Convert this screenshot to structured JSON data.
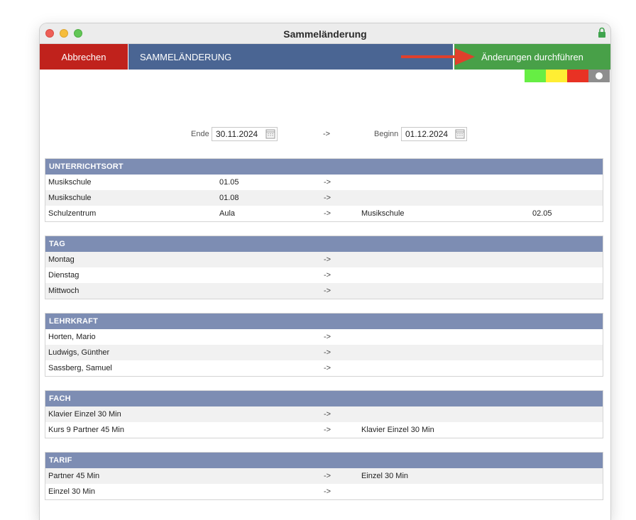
{
  "window": {
    "title": "Sammeländerung"
  },
  "toolbar": {
    "cancel_label": "Abbrechen",
    "title": "SAMMELÄNDERUNG",
    "execute_label": "Änderungen durchführen"
  },
  "colors": {
    "cancel": "#c0221c",
    "header": "#4a6593",
    "execute": "#48a048",
    "section": "#7d8db3",
    "swatches": [
      "#66ee44",
      "#ffee33",
      "#e83224",
      "#8e8e8e"
    ]
  },
  "dates": {
    "end_label": "Ende",
    "end_value": "30.11.2024",
    "arrow": "->",
    "begin_label": "Beginn",
    "begin_value": "01.12.2024"
  },
  "sections": [
    {
      "title": "UNTERRICHTSORT",
      "rows": [
        {
          "c1": "Musikschule",
          "c2": "01.05",
          "arrow": "->",
          "c4": "",
          "c5": ""
        },
        {
          "c1": "Musikschule",
          "c2": "01.08",
          "arrow": "->",
          "c4": "",
          "c5": ""
        },
        {
          "c1": "Schulzentrum",
          "c2": "Aula",
          "arrow": "->",
          "c4": "Musikschule",
          "c5": "02.05"
        }
      ]
    },
    {
      "title": "TAG",
      "rows": [
        {
          "c1": "Montag",
          "c2": "",
          "arrow": "->",
          "c4": "",
          "c5": ""
        },
        {
          "c1": "Dienstag",
          "c2": "",
          "arrow": "->",
          "c4": "",
          "c5": ""
        },
        {
          "c1": "Mittwoch",
          "c2": "",
          "arrow": "->",
          "c4": "",
          "c5": ""
        }
      ]
    },
    {
      "title": "LEHRKRAFT",
      "rows": [
        {
          "c1": "Horten, Mario",
          "c2": "",
          "arrow": "->",
          "c4": "",
          "c5": ""
        },
        {
          "c1": "Ludwigs, Günther",
          "c2": "",
          "arrow": "->",
          "c4": "",
          "c5": ""
        },
        {
          "c1": "Sassberg, Samuel",
          "c2": "",
          "arrow": "->",
          "c4": "",
          "c5": ""
        }
      ]
    },
    {
      "title": "FACH",
      "rows": [
        {
          "c1": "Klavier Einzel 30 Min",
          "c2": "",
          "arrow": "->",
          "c4": "",
          "c5": ""
        },
        {
          "c1": "Kurs 9 Partner 45 Min",
          "c2": "",
          "arrow": "->",
          "c4": "Klavier Einzel 30 Min",
          "c5": ""
        }
      ]
    },
    {
      "title": "TARIF",
      "rows": [
        {
          "c1": "Partner 45 Min",
          "c2": "",
          "arrow": "->",
          "c4": "Einzel 30 Min",
          "c5": ""
        },
        {
          "c1": "Einzel 30 Min",
          "c2": "",
          "arrow": "->",
          "c4": "",
          "c5": ""
        }
      ]
    }
  ]
}
